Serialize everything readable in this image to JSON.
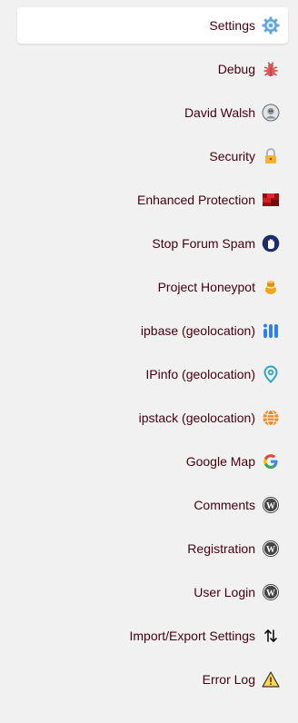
{
  "menu": {
    "items": [
      {
        "label": "Settings",
        "icon": "gear-icon",
        "active": true
      },
      {
        "label": "Debug",
        "icon": "bug-icon"
      },
      {
        "label": "David Walsh",
        "icon": "avatar-icon"
      },
      {
        "label": "Security",
        "icon": "lock-icon"
      },
      {
        "label": "Enhanced Protection",
        "icon": "shield-block-icon"
      },
      {
        "label": "Stop Forum Spam",
        "icon": "hand-stop-icon"
      },
      {
        "label": "Project Honeypot",
        "icon": "honeypot-icon"
      },
      {
        "label": "ipbase (geolocation)",
        "icon": "bars-icon"
      },
      {
        "label": "IPinfo (geolocation)",
        "icon": "location-pin-icon"
      },
      {
        "label": "ipstack (geolocation)",
        "icon": "globe-icon"
      },
      {
        "label": "Google Map",
        "icon": "google-icon"
      },
      {
        "label": "Comments",
        "icon": "wordpress-icon"
      },
      {
        "label": "Registration",
        "icon": "wordpress-icon"
      },
      {
        "label": "User Login",
        "icon": "wordpress-icon"
      },
      {
        "label": "Import/Export Settings",
        "icon": "import-export-icon"
      },
      {
        "label": "Error Log",
        "icon": "warning-icon"
      }
    ]
  },
  "colors": {
    "label": "#46000f",
    "background": "#f1f1f1",
    "active_background": "#ffffff"
  }
}
